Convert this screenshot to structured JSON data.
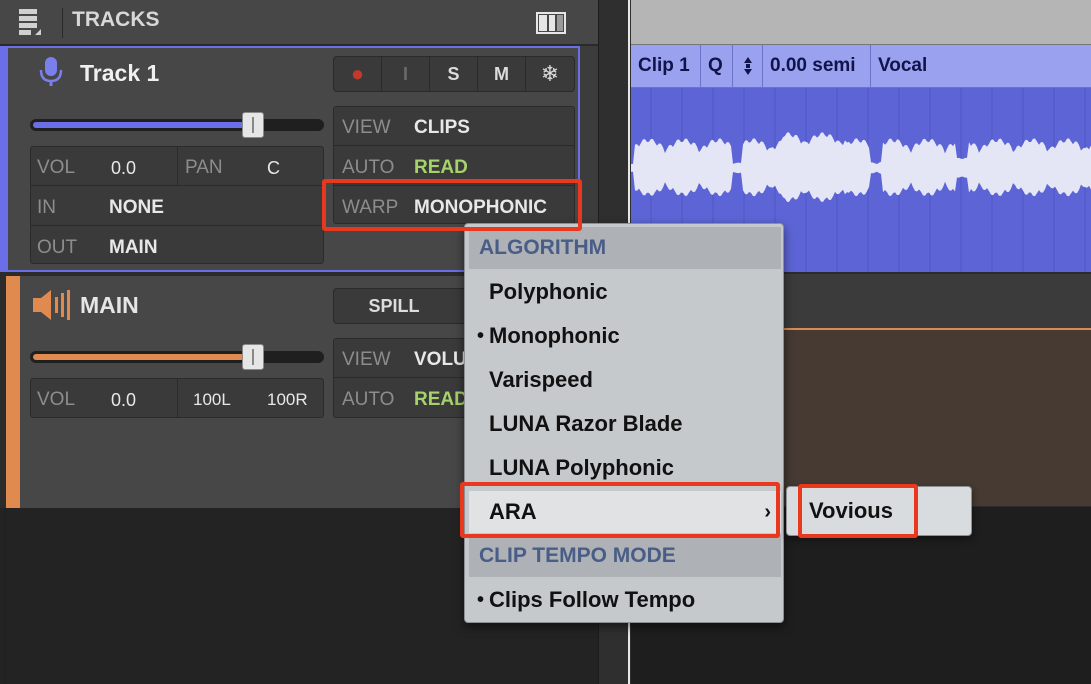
{
  "header": {
    "title": "TRACKS"
  },
  "clip_header": {
    "clip_name": "Clip 1",
    "quantize": "Q",
    "pitch": "0.00 semi",
    "track_label": "Vocal"
  },
  "track1": {
    "name": "Track 1",
    "buttons": {
      "record": "●",
      "input": "I",
      "solo": "S",
      "mute": "M",
      "freeze": "❄"
    },
    "fader_level": 0.78,
    "vol_label": "VOL",
    "vol_value": "0.0",
    "pan_label": "PAN",
    "pan_value": "C",
    "in_label": "IN",
    "in_value": "NONE",
    "out_label": "OUT",
    "out_value": "MAIN",
    "view_label": "VIEW",
    "view_value": "CLIPS",
    "auto_label": "AUTO",
    "auto_value": "READ",
    "warp_label": "WARP",
    "warp_value": "MONOPHONIC"
  },
  "main_track": {
    "name": "MAIN",
    "spill_label": "SPILL",
    "fader_level": 0.78,
    "vol_label": "VOL",
    "vol_value": "0.0",
    "pan_left": "100L",
    "pan_right": "100R",
    "view_label": "VIEW",
    "view_value": "VOLU",
    "auto_label": "AUTO",
    "auto_value": "READ"
  },
  "menu": {
    "algorithm_header": "ALGORITHM",
    "items": [
      "Polyphonic",
      "Monophonic",
      "Varispeed",
      "LUNA Razor Blade",
      "LUNA Polyphonic",
      "ARA"
    ],
    "selected": "Monophonic",
    "bullet": "•",
    "chevron": "›",
    "clip_tempo_header": "CLIP TEMPO MODE",
    "tempo_item": "Clips Follow Tempo"
  },
  "submenu": {
    "item": "Vovious"
  },
  "colors": {
    "track_accent": "#6a6fe8",
    "main_accent": "#e08a4f",
    "auto_read": "#a6d26a",
    "highlight": "#e8391f",
    "clip": "#5d65d6"
  }
}
